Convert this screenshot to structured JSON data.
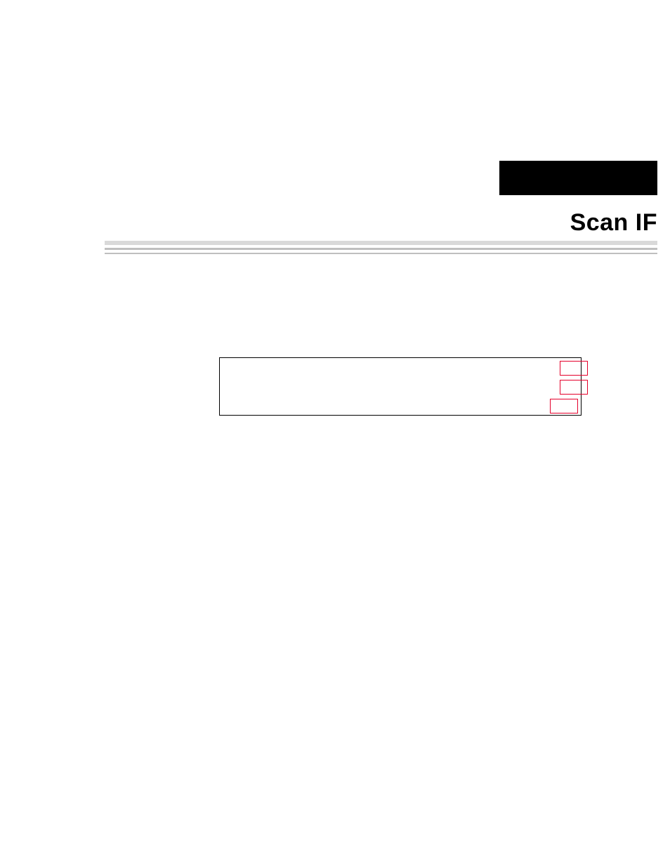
{
  "header": {
    "title": "Scan IF"
  }
}
